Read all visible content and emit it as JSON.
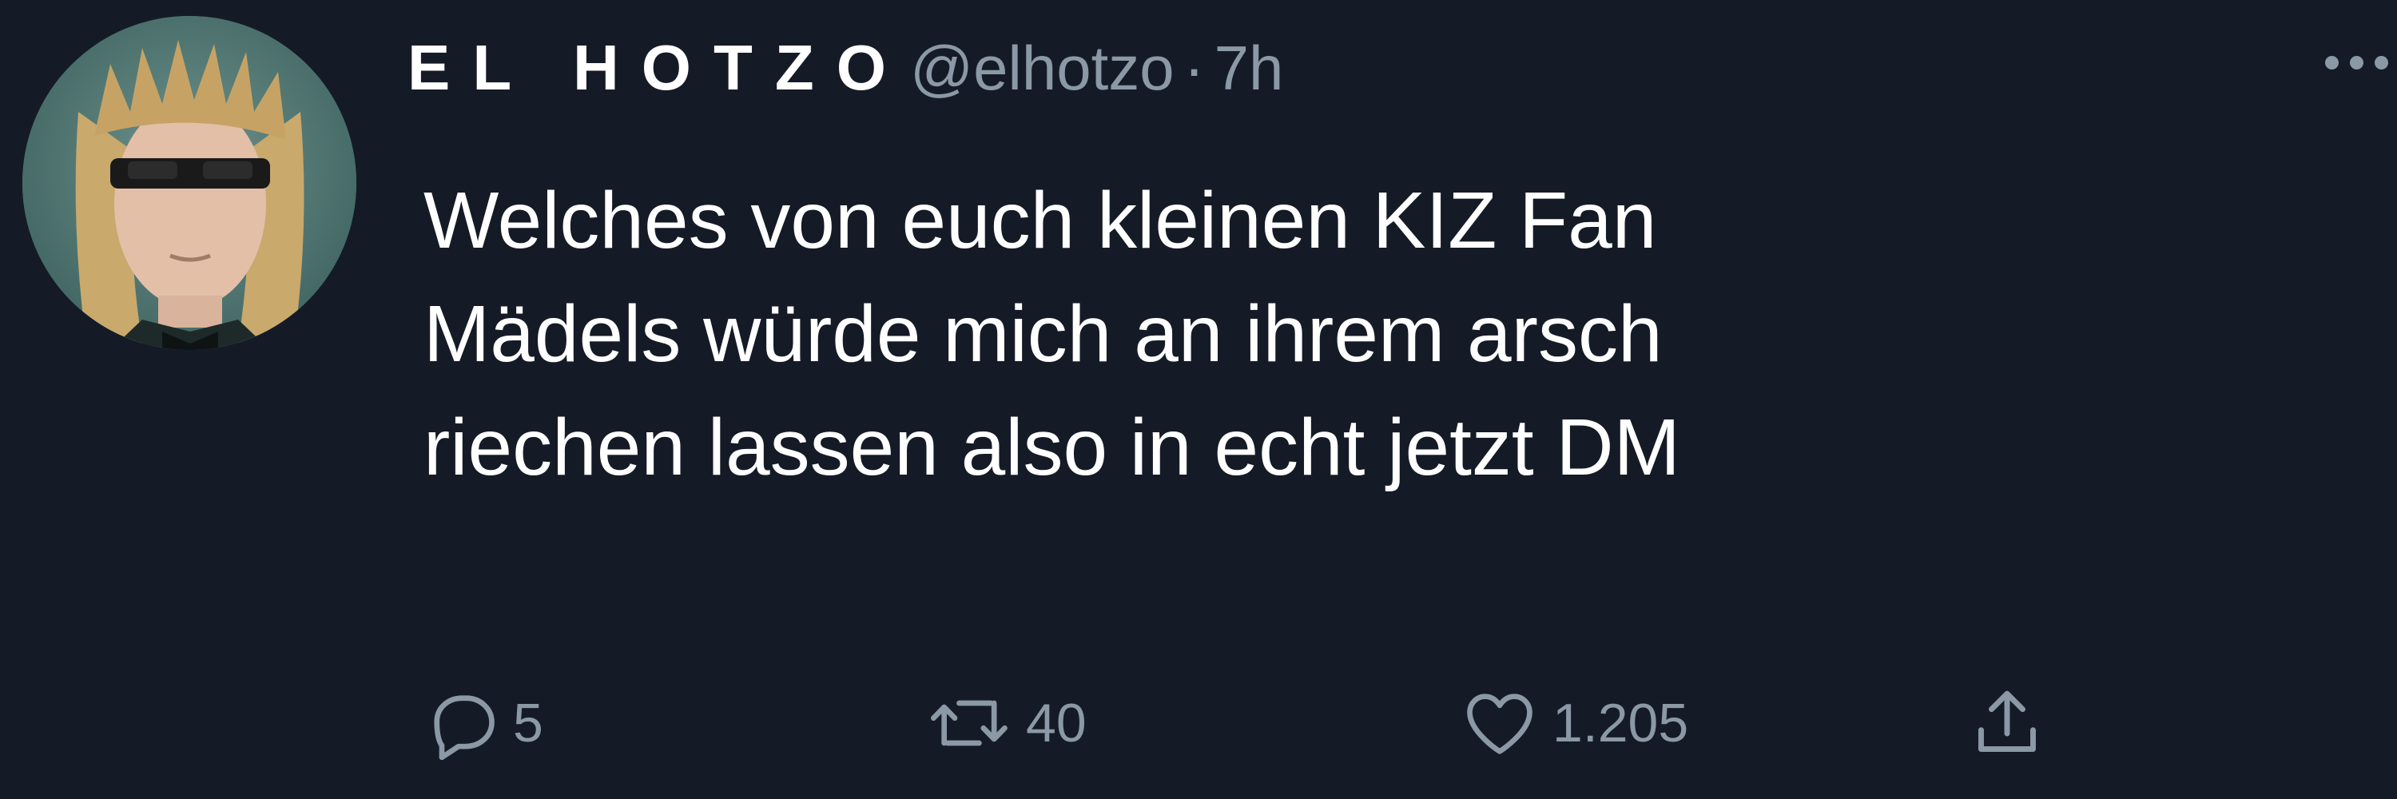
{
  "tweet": {
    "author": {
      "display_name": "EL HOTZO",
      "handle": "@elhotzo",
      "separator": "·",
      "time": "7h"
    },
    "lines": [
      "Welches von euch kleinen KIZ Fan",
      "Mädels würde mich an ihrem arsch",
      "riechen lassen also in echt jetzt DM"
    ],
    "actions": {
      "replies": "5",
      "retweets": "40",
      "likes": "1.205"
    },
    "icons": {
      "reply": "reply-icon",
      "retweet": "retweet-icon",
      "like": "heart-icon",
      "share": "share-icon",
      "more": "more-icon"
    },
    "colors": {
      "background": "#151b26",
      "text": "#ffffff",
      "secondary": "#8b98a5"
    }
  }
}
